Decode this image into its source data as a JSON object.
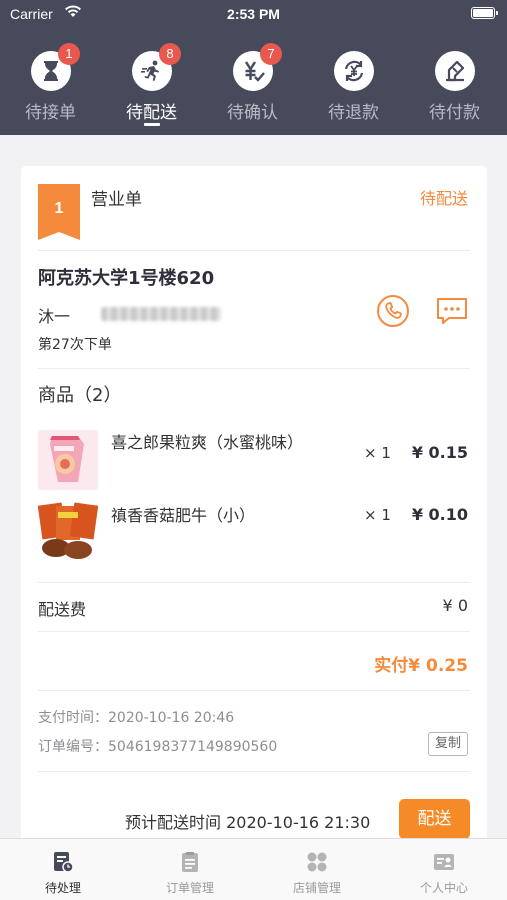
{
  "status_bar": {
    "carrier": "Carrier",
    "time": "2:53 PM"
  },
  "tabs": [
    {
      "label": "待接单",
      "icon": "hourglass-icon",
      "badge": "1"
    },
    {
      "label": "待配送",
      "icon": "runner-icon",
      "badge": "8",
      "active": true
    },
    {
      "label": "待确认",
      "icon": "yen-check-icon",
      "badge": "7"
    },
    {
      "label": "待退款",
      "icon": "yen-refund-icon",
      "badge": ""
    },
    {
      "label": "待付款",
      "icon": "pay-icon",
      "badge": ""
    }
  ],
  "order": {
    "index": "1",
    "type": "营业单",
    "status": "待配送",
    "address": "阿克苏大学1号楼620",
    "customer": "沐一",
    "order_count": "第27次下单",
    "goods_title": "商品（2）",
    "items": [
      {
        "name": "喜之郎果粒爽（水蜜桃味）",
        "qty": "× 1",
        "price": "¥ 0.15"
      },
      {
        "name": "禛香香菇肥牛（小）",
        "qty": "× 1",
        "price": "¥ 0.10"
      }
    ],
    "fee_label": "配送费",
    "fee_value": "¥ 0",
    "paid": "实付¥ 0.25",
    "pay_time": "支付时间：2020-10-16 20:46",
    "order_no": "订单编号：5046198377149890560",
    "copy_label": "复制",
    "eta": "预计配送时间 2020-10-16 21:30",
    "deliver_label": "配送"
  },
  "bottom_nav": [
    {
      "label": "待处理",
      "icon": "pending-icon",
      "active": true
    },
    {
      "label": "订单管理",
      "icon": "orders-icon"
    },
    {
      "label": "店铺管理",
      "icon": "store-icon"
    },
    {
      "label": "个人中心",
      "icon": "profile-icon"
    }
  ],
  "colors": {
    "header": "#474a5a",
    "accent": "#f58a3c",
    "badge": "#e8584f"
  }
}
